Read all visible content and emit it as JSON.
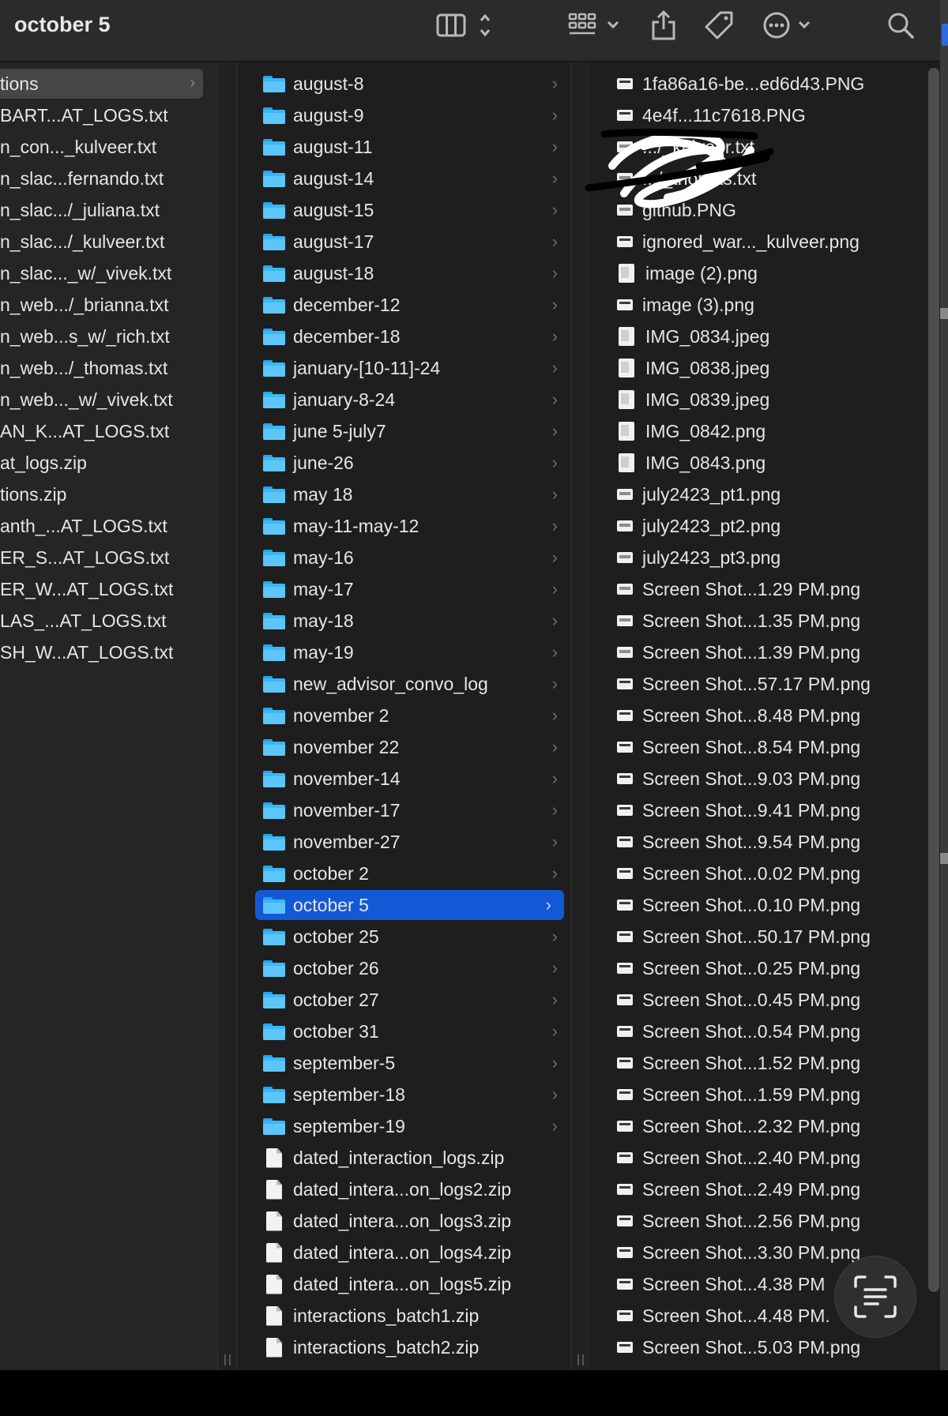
{
  "window": {
    "title": "october 5"
  },
  "toolbar": {
    "icons": [
      "columns-view-icon",
      "group-by-icon",
      "share-icon",
      "tag-icon",
      "more-actions-icon",
      "search-icon"
    ]
  },
  "column1": {
    "items": [
      {
        "label": "tions",
        "selected": true
      },
      {
        "label": "BART...AT_LOGS.txt"
      },
      {
        "label": "n_con..._kulveer.txt"
      },
      {
        "label": "n_slac...fernando.txt"
      },
      {
        "label": "n_slac.../_juliana.txt"
      },
      {
        "label": "n_slac.../_kulveer.txt"
      },
      {
        "label": "n_slac..._w/_vivek.txt"
      },
      {
        "label": "n_web.../_brianna.txt"
      },
      {
        "label": "n_web...s_w/_rich.txt"
      },
      {
        "label": "n_web.../_thomas.txt"
      },
      {
        "label": "n_web..._w/_vivek.txt"
      },
      {
        "label": "AN_K...AT_LOGS.txt"
      },
      {
        "label": "at_logs.zip"
      },
      {
        "label": "tions.zip"
      },
      {
        "label": "anth_...AT_LOGS.txt"
      },
      {
        "label": "ER_S...AT_LOGS.txt"
      },
      {
        "label": "ER_W...AT_LOGS.txt"
      },
      {
        "label": "LAS_...AT_LOGS.txt"
      },
      {
        "label": "SH_W...AT_LOGS.txt"
      }
    ]
  },
  "column2": {
    "items": [
      {
        "label": "august-8",
        "type": "folder"
      },
      {
        "label": "august-9",
        "type": "folder"
      },
      {
        "label": "august-11",
        "type": "folder"
      },
      {
        "label": "august-14",
        "type": "folder"
      },
      {
        "label": "august-15",
        "type": "folder"
      },
      {
        "label": "august-17",
        "type": "folder"
      },
      {
        "label": "august-18",
        "type": "folder"
      },
      {
        "label": "december-12",
        "type": "folder"
      },
      {
        "label": "december-18",
        "type": "folder"
      },
      {
        "label": "january-[10-11]-24",
        "type": "folder"
      },
      {
        "label": "january-8-24",
        "type": "folder"
      },
      {
        "label": "june 5-july7",
        "type": "folder"
      },
      {
        "label": "june-26",
        "type": "folder"
      },
      {
        "label": "may 18",
        "type": "folder"
      },
      {
        "label": "may-11-may-12",
        "type": "folder"
      },
      {
        "label": "may-16",
        "type": "folder"
      },
      {
        "label": "may-17",
        "type": "folder"
      },
      {
        "label": "may-18",
        "type": "folder"
      },
      {
        "label": "may-19",
        "type": "folder"
      },
      {
        "label": "new_advisor_convo_log",
        "type": "folder"
      },
      {
        "label": "november 2",
        "type": "folder"
      },
      {
        "label": "november 22",
        "type": "folder"
      },
      {
        "label": "november-14",
        "type": "folder"
      },
      {
        "label": "november-17",
        "type": "folder"
      },
      {
        "label": "november-27",
        "type": "folder"
      },
      {
        "label": "october 2",
        "type": "folder"
      },
      {
        "label": "october 5",
        "type": "folder",
        "selected": true
      },
      {
        "label": "october 25",
        "type": "folder"
      },
      {
        "label": "october 26",
        "type": "folder"
      },
      {
        "label": "october 27",
        "type": "folder"
      },
      {
        "label": "october 31",
        "type": "folder"
      },
      {
        "label": "september-5",
        "type": "folder"
      },
      {
        "label": "september-18",
        "type": "folder"
      },
      {
        "label": "september-19",
        "type": "folder"
      },
      {
        "label": "dated_interaction_logs.zip",
        "type": "file"
      },
      {
        "label": "dated_intera...on_logs2.zip",
        "type": "file"
      },
      {
        "label": "dated_intera...on_logs3.zip",
        "type": "file"
      },
      {
        "label": "dated_intera...on_logs4.zip",
        "type": "file"
      },
      {
        "label": "dated_intera...on_logs5.zip",
        "type": "file"
      },
      {
        "label": "interactions_batch1.zip",
        "type": "file"
      },
      {
        "label": "interactions_batch2.zip",
        "type": "file"
      }
    ]
  },
  "column3": {
    "items": [
      {
        "label": "1fa86a16-be...ed6d43.PNG",
        "icon": "shot"
      },
      {
        "label": "4e4f...11c7618.PNG",
        "icon": "shot"
      },
      {
        "label": ".../_kulveer.txt",
        "icon": "img"
      },
      {
        "label": ".../_thomas.txt",
        "icon": "img"
      },
      {
        "label": "github.PNG",
        "icon": "img"
      },
      {
        "label": "ignored_war..._kulveer.png",
        "icon": "shot"
      },
      {
        "label": "image (2).png",
        "icon": "tall"
      },
      {
        "label": "image (3).png",
        "icon": "shot"
      },
      {
        "label": "IMG_0834.jpeg",
        "icon": "tall"
      },
      {
        "label": "IMG_0838.jpeg",
        "icon": "tall"
      },
      {
        "label": "IMG_0839.jpeg",
        "icon": "tall"
      },
      {
        "label": "IMG_0842.png",
        "icon": "tall"
      },
      {
        "label": "IMG_0843.png",
        "icon": "tall"
      },
      {
        "label": "july2423_pt1.png",
        "icon": "img"
      },
      {
        "label": "july2423_pt2.png",
        "icon": "img"
      },
      {
        "label": "july2423_pt3.png",
        "icon": "img"
      },
      {
        "label": "Screen Shot...1.29 PM.png",
        "icon": "img"
      },
      {
        "label": "Screen Shot...1.35 PM.png",
        "icon": "img"
      },
      {
        "label": "Screen Shot...1.39 PM.png",
        "icon": "img"
      },
      {
        "label": "Screen Shot...57.17 PM.png",
        "icon": "shot"
      },
      {
        "label": "Screen Shot...8.48 PM.png",
        "icon": "shot"
      },
      {
        "label": "Screen Shot...8.54 PM.png",
        "icon": "shot"
      },
      {
        "label": "Screen Shot...9.03 PM.png",
        "icon": "shot"
      },
      {
        "label": "Screen Shot...9.41 PM.png",
        "icon": "shot"
      },
      {
        "label": "Screen Shot...9.54 PM.png",
        "icon": "shot"
      },
      {
        "label": "Screen Shot...0.02 PM.png",
        "icon": "shot"
      },
      {
        "label": "Screen Shot...0.10 PM.png",
        "icon": "shot"
      },
      {
        "label": "Screen Shot...50.17 PM.png",
        "icon": "shot"
      },
      {
        "label": "Screen Shot...0.25 PM.png",
        "icon": "shot"
      },
      {
        "label": "Screen Shot...0.45 PM.png",
        "icon": "shot"
      },
      {
        "label": "Screen Shot...0.54 PM.png",
        "icon": "shot"
      },
      {
        "label": "Screen Shot...1.52 PM.png",
        "icon": "shot"
      },
      {
        "label": "Screen Shot...1.59 PM.png",
        "icon": "shot"
      },
      {
        "label": "Screen Shot...2.32 PM.png",
        "icon": "shot"
      },
      {
        "label": "Screen Shot...2.40 PM.png",
        "icon": "shot"
      },
      {
        "label": "Screen Shot...2.49 PM.png",
        "icon": "shot"
      },
      {
        "label": "Screen Shot...2.56 PM.png",
        "icon": "shot"
      },
      {
        "label": "Screen Shot...3.30 PM.png",
        "icon": "shot"
      },
      {
        "label": "Screen Shot...4.38 PM",
        "icon": "shot"
      },
      {
        "label": "Screen Shot...4.48 PM.",
        "icon": "shot"
      },
      {
        "label": "Screen Shot...5.03 PM.png",
        "icon": "shot"
      }
    ]
  },
  "colors": {
    "selection_blue": "#1359d6",
    "folder_blue": "#3cb7f5",
    "background": "#1e1e1e",
    "toolbar": "#2b2b2b"
  }
}
